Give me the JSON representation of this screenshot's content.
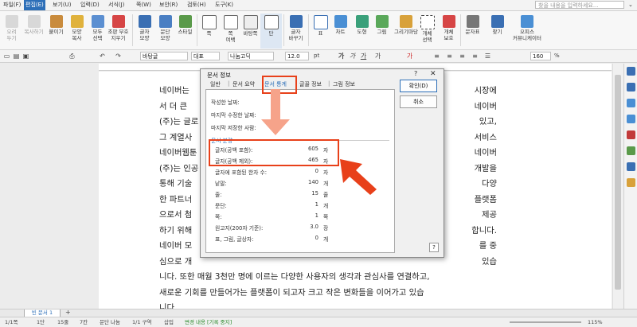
{
  "menubar": {
    "items": [
      "파일(F)",
      "편집(E)",
      "보기(U)",
      "입력(D)",
      "서식(J)",
      "쪽(W)",
      "보안(R)",
      "검토(H)",
      "도구(K)"
    ],
    "active_index": 1,
    "help_placeholder": "찾을 내용을 입력하세요..."
  },
  "ribbon": {
    "buttons": [
      {
        "label": "오려\n두기",
        "icon": "scissors-icon",
        "disabled": true
      },
      {
        "label": "복사하기",
        "icon": "copy-icon",
        "disabled": true
      },
      {
        "label": "붙이기",
        "icon": "paste-icon",
        "disabled": false
      },
      {
        "label": "모양\n복사",
        "icon": "format-painter-icon",
        "disabled": false
      },
      {
        "label": "모두\n선택",
        "icon": "select-all-icon",
        "disabled": false
      },
      {
        "label": "조판 부호\n지우기",
        "icon": "clear-code-icon",
        "disabled": false
      },
      {
        "label": "글자\n모양",
        "icon": "char-shape-icon",
        "disabled": false
      },
      {
        "label": "문단\n모양",
        "icon": "para-shape-icon",
        "disabled": false
      },
      {
        "label": "스타일",
        "icon": "style-icon",
        "disabled": false
      },
      {
        "label": "쪽",
        "icon": "page-icon",
        "disabled": false
      },
      {
        "label": "쪽\n여백",
        "icon": "margin-icon",
        "disabled": false
      },
      {
        "label": "바탕쪽",
        "icon": "master-page-icon",
        "disabled": false
      },
      {
        "label": "단",
        "icon": "columns-icon",
        "disabled": false
      },
      {
        "label": "글자\n바꾸기",
        "icon": "replace-char-icon",
        "disabled": false
      },
      {
        "label": "표",
        "icon": "table-icon",
        "disabled": false
      },
      {
        "label": "차트",
        "icon": "chart-icon",
        "disabled": false
      },
      {
        "label": "도형",
        "icon": "shape-icon",
        "disabled": false
      },
      {
        "label": "그림",
        "icon": "picture-icon",
        "disabled": false
      },
      {
        "label": "그리기마당",
        "icon": "clipart-icon",
        "disabled": false
      },
      {
        "label": "개체\n선택",
        "icon": "object-select-icon",
        "disabled": false
      },
      {
        "label": "개체\n보호",
        "icon": "object-protect-icon",
        "disabled": false
      },
      {
        "label": "문자표",
        "icon": "symbol-icon",
        "disabled": false
      },
      {
        "label": "찾기",
        "icon": "find-icon",
        "disabled": false
      },
      {
        "label": "오피스\n커뮤니케이터",
        "icon": "communicator-icon",
        "disabled": false
      }
    ]
  },
  "formatbar": {
    "style": "바탕글",
    "lang": "대표",
    "font": "나눔고딕",
    "size": "12.0",
    "size_unit": "pt",
    "zoom": "160",
    "zoom_unit": "%"
  },
  "document": {
    "lines": [
      "네이버는 ",
      "서 더 큰 ",
      "(주)는 글로",
      "그 계열사",
      "네이버웹툰",
      "(주)는 인공",
      "통해 기술",
      "한 파트너",
      "으로서 첨",
      "하기 위해",
      "네이버 모",
      "심으로 개",
      "니다. 또한 매월 3천만 명에 이르는 다양한 사용자의 생각과 관심사를 연결하고,",
      "새로운 기회를 만들어가는 플랫폼이 되고자 크고 작은 변화들을 이어가고 있습",
      "니다."
    ],
    "right_fragments": [
      "시장에",
      "네이버",
      "있고,",
      "서비스",
      "네이버",
      "개발을",
      "다양",
      "플랫폼",
      "제공",
      "합니다.",
      "를 중",
      "있습"
    ]
  },
  "dialog": {
    "title": "문서 정보",
    "help": "?",
    "close": "✕",
    "tabs": [
      "일반",
      "문서 요약",
      "문서 통계",
      "글꼴 정보",
      "그림 정보"
    ],
    "active_tab": 2,
    "general": {
      "created_label": "작성한 날짜:",
      "modified_label": "마지막 수정한 날짜:",
      "saved_by_label": "마지막 저장한 사람:"
    },
    "section_label": "문서 분량",
    "stats": [
      {
        "label": "글자(공백 포함):",
        "value": "605",
        "unit": "자"
      },
      {
        "label": "글자(공백 제외):",
        "value": "465",
        "unit": "자"
      },
      {
        "label": "글자에 포함된 한자 수:",
        "value": "0",
        "unit": "자"
      },
      {
        "label": "낱말:",
        "value": "140",
        "unit": "개"
      },
      {
        "label": "줄:",
        "value": "15",
        "unit": "줄"
      },
      {
        "label": "문단:",
        "value": "1",
        "unit": "개"
      },
      {
        "label": "쪽:",
        "value": "1",
        "unit": "쪽"
      },
      {
        "label": "원고지(200자 기준):",
        "value": "3.0",
        "unit": "장"
      },
      {
        "label": "표, 그림, 글상자:",
        "value": "0",
        "unit": "개"
      }
    ],
    "ok_label": "확인(D)",
    "cancel_label": "취소",
    "question": "?"
  },
  "tabbar": {
    "doc_tab": "빈 문서 1",
    "add": "+"
  },
  "statusbar": {
    "items": [
      "1/1쪽",
      "1단",
      "15줄",
      "7칸",
      "문단 나눔",
      "1/1 구역",
      "삽입",
      "변경 내용 [기록 중지]"
    ],
    "zoom": "115%"
  },
  "colors": {
    "accent": "#2d6fb8",
    "annotation": "#e8401a",
    "annotation_light": "#f6a38a"
  }
}
